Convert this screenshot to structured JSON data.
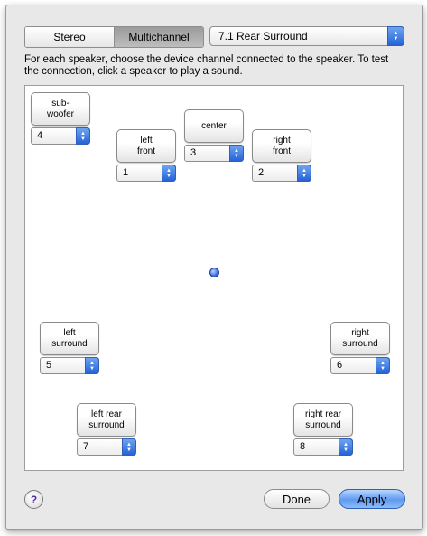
{
  "mode_tabs": [
    "Stereo",
    "Multichannel"
  ],
  "selected_mode": "Multichannel",
  "layout_popup": {
    "value": "7.1 Rear Surround"
  },
  "instructions": "For each speaker, choose the device channel connected to the speaker. To test the connection, click a speaker to play a sound.",
  "speakers": [
    {
      "id": "subwoofer",
      "lines": [
        "sub-",
        "woofer"
      ],
      "channel": "4"
    },
    {
      "id": "left-front",
      "lines": [
        "left",
        "front"
      ],
      "channel": "1"
    },
    {
      "id": "center",
      "lines": [
        "center"
      ],
      "channel": "3"
    },
    {
      "id": "right-front",
      "lines": [
        "right",
        "front"
      ],
      "channel": "2"
    },
    {
      "id": "left-surround",
      "lines": [
        "left",
        "surround"
      ],
      "channel": "5"
    },
    {
      "id": "right-surround",
      "lines": [
        "right",
        "surround"
      ],
      "channel": "6"
    },
    {
      "id": "left-rear-surround",
      "lines": [
        "left rear",
        "surround"
      ],
      "channel": "7"
    },
    {
      "id": "right-rear-surround",
      "lines": [
        "right rear",
        "surround"
      ],
      "channel": "8"
    }
  ],
  "help_label": "?",
  "done_label": "Done",
  "apply_label": "Apply"
}
